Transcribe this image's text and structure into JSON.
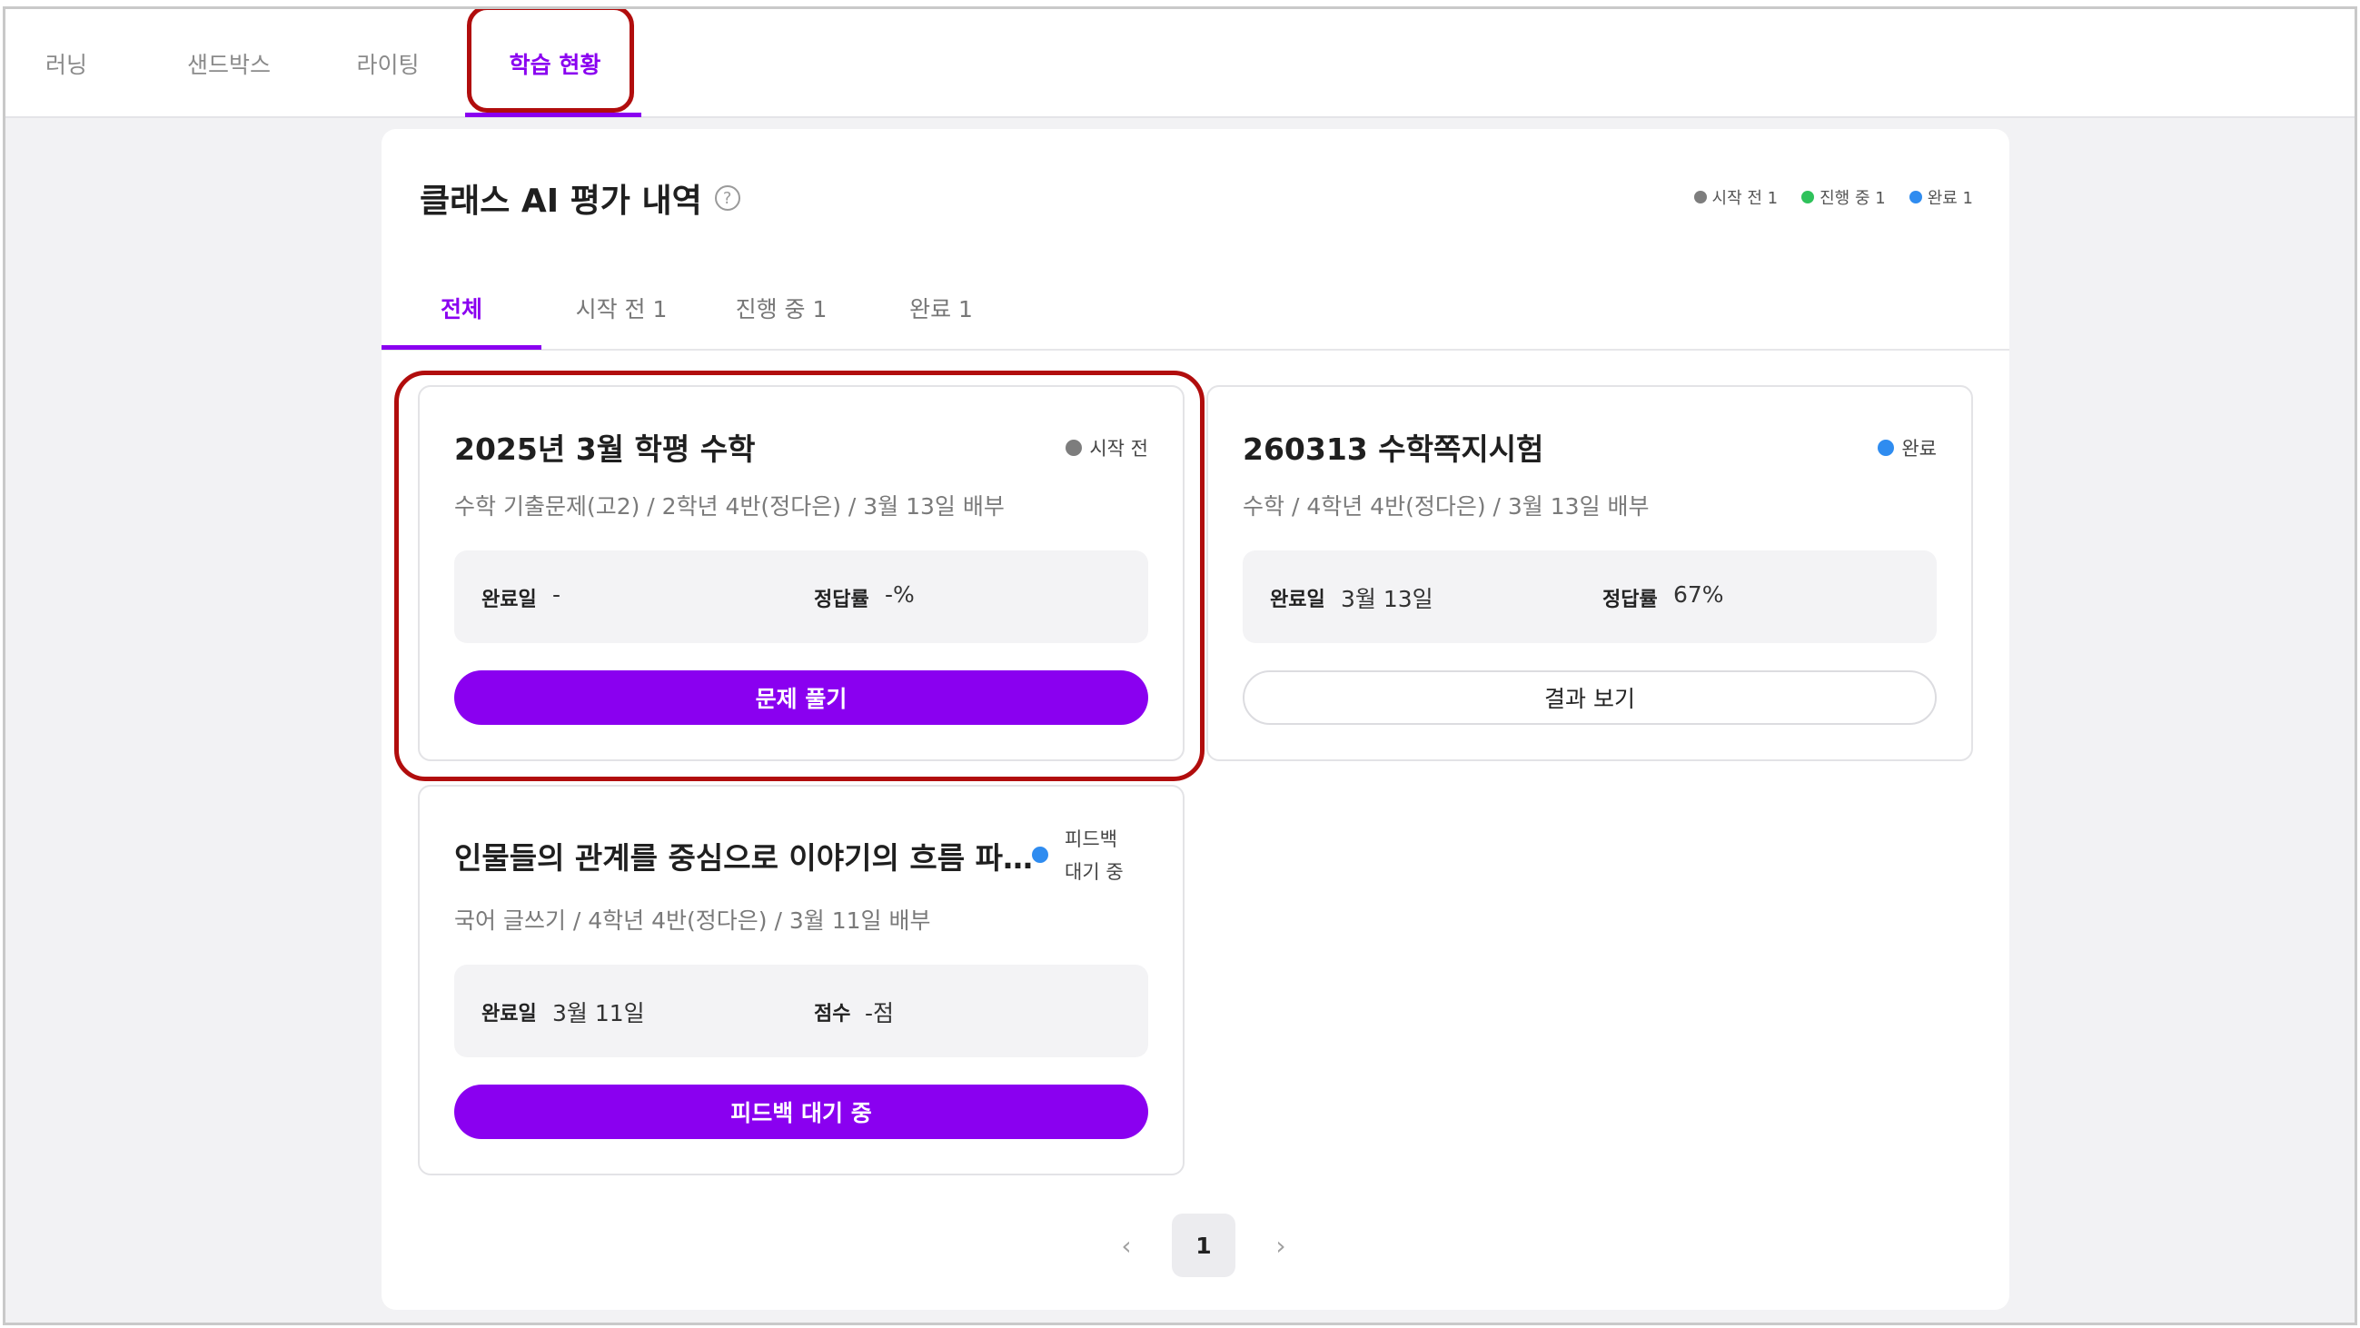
{
  "topnav": {
    "tabs": [
      {
        "label": "러닝"
      },
      {
        "label": "샌드박스"
      },
      {
        "label": "라이팅"
      },
      {
        "label": "학습 현황"
      }
    ],
    "active_index": 3
  },
  "panel": {
    "title": "클래스 AI 평가 내역",
    "help_icon": "question-circle-icon",
    "legend": [
      {
        "label": "시작 전 1",
        "color": "#7d7d7d"
      },
      {
        "label": "진행 중 1",
        "color": "#2fc25b"
      },
      {
        "label": "완료 1",
        "color": "#2f8cf0"
      }
    ]
  },
  "subtabs": {
    "items": [
      {
        "label": "전체"
      },
      {
        "label": "시작 전 1"
      },
      {
        "label": "진행 중 1"
      },
      {
        "label": "완료 1"
      }
    ],
    "active_index": 0
  },
  "cards": [
    {
      "title": "2025년 3월 학평 수학",
      "status": "시작 전",
      "status_color": "#7d7d7d",
      "subtitle": "수학 기출문제(고2) / 2학년 4반(정다은) / 3월 13일 배부",
      "info": [
        {
          "label": "완료일",
          "value": "-"
        },
        {
          "label": "정답률",
          "value": "-%"
        }
      ],
      "button": "문제 풀기"
    },
    {
      "title": "260313 수학쪽지시험",
      "status": "완료",
      "status_color": "#2f8cf0",
      "subtitle": "수학 / 4학년 4반(정다은) / 3월 13일 배부",
      "info": [
        {
          "label": "완료일",
          "value": "3월 13일"
        },
        {
          "label": "정답률",
          "value": "67%"
        }
      ],
      "button": "결과 보기"
    },
    {
      "title": "인물들의 관계를 중심으로 이야기의 흐름 파...",
      "status_line1": "피드백",
      "status_line2": "대기 중",
      "status_color": "#2f8cf0",
      "subtitle": "국어 글쓰기 / 4학년 4반(정다은) / 3월 11일 배부",
      "info": [
        {
          "label": "완료일",
          "value": "3월 11일"
        },
        {
          "label": "점수",
          "value": "-점"
        }
      ],
      "button": "피드백 대기 중"
    }
  ],
  "pagination": {
    "prev": "‹",
    "current": "1",
    "next": "›"
  }
}
